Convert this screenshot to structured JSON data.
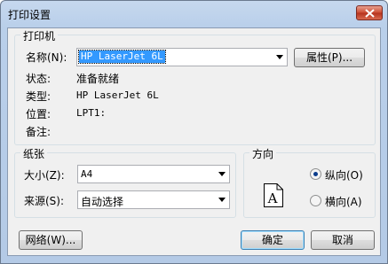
{
  "window": {
    "title": "打印设置"
  },
  "printer": {
    "group_label": "打印机",
    "name_label": "名称(N):",
    "name_value": "HP LaserJet 6L",
    "properties_button": "属性(P)...",
    "status_label": "状态:",
    "status_value": "准备就绪",
    "type_label": "类型:",
    "type_value": "HP LaserJet 6L",
    "location_label": "位置:",
    "location_value": "LPT1:",
    "comment_label": "备注:",
    "comment_value": ""
  },
  "paper": {
    "group_label": "纸张",
    "size_label": "大小(Z):",
    "size_value": "A4",
    "source_label": "来源(S):",
    "source_value": "自动选择"
  },
  "orientation": {
    "group_label": "方向",
    "portrait_label": "纵向(O)",
    "landscape_label": "横向(A)",
    "selected": "portrait",
    "page_icon_letter": "A"
  },
  "buttons": {
    "network": "网络(W)...",
    "ok": "确定",
    "cancel": "取消"
  }
}
